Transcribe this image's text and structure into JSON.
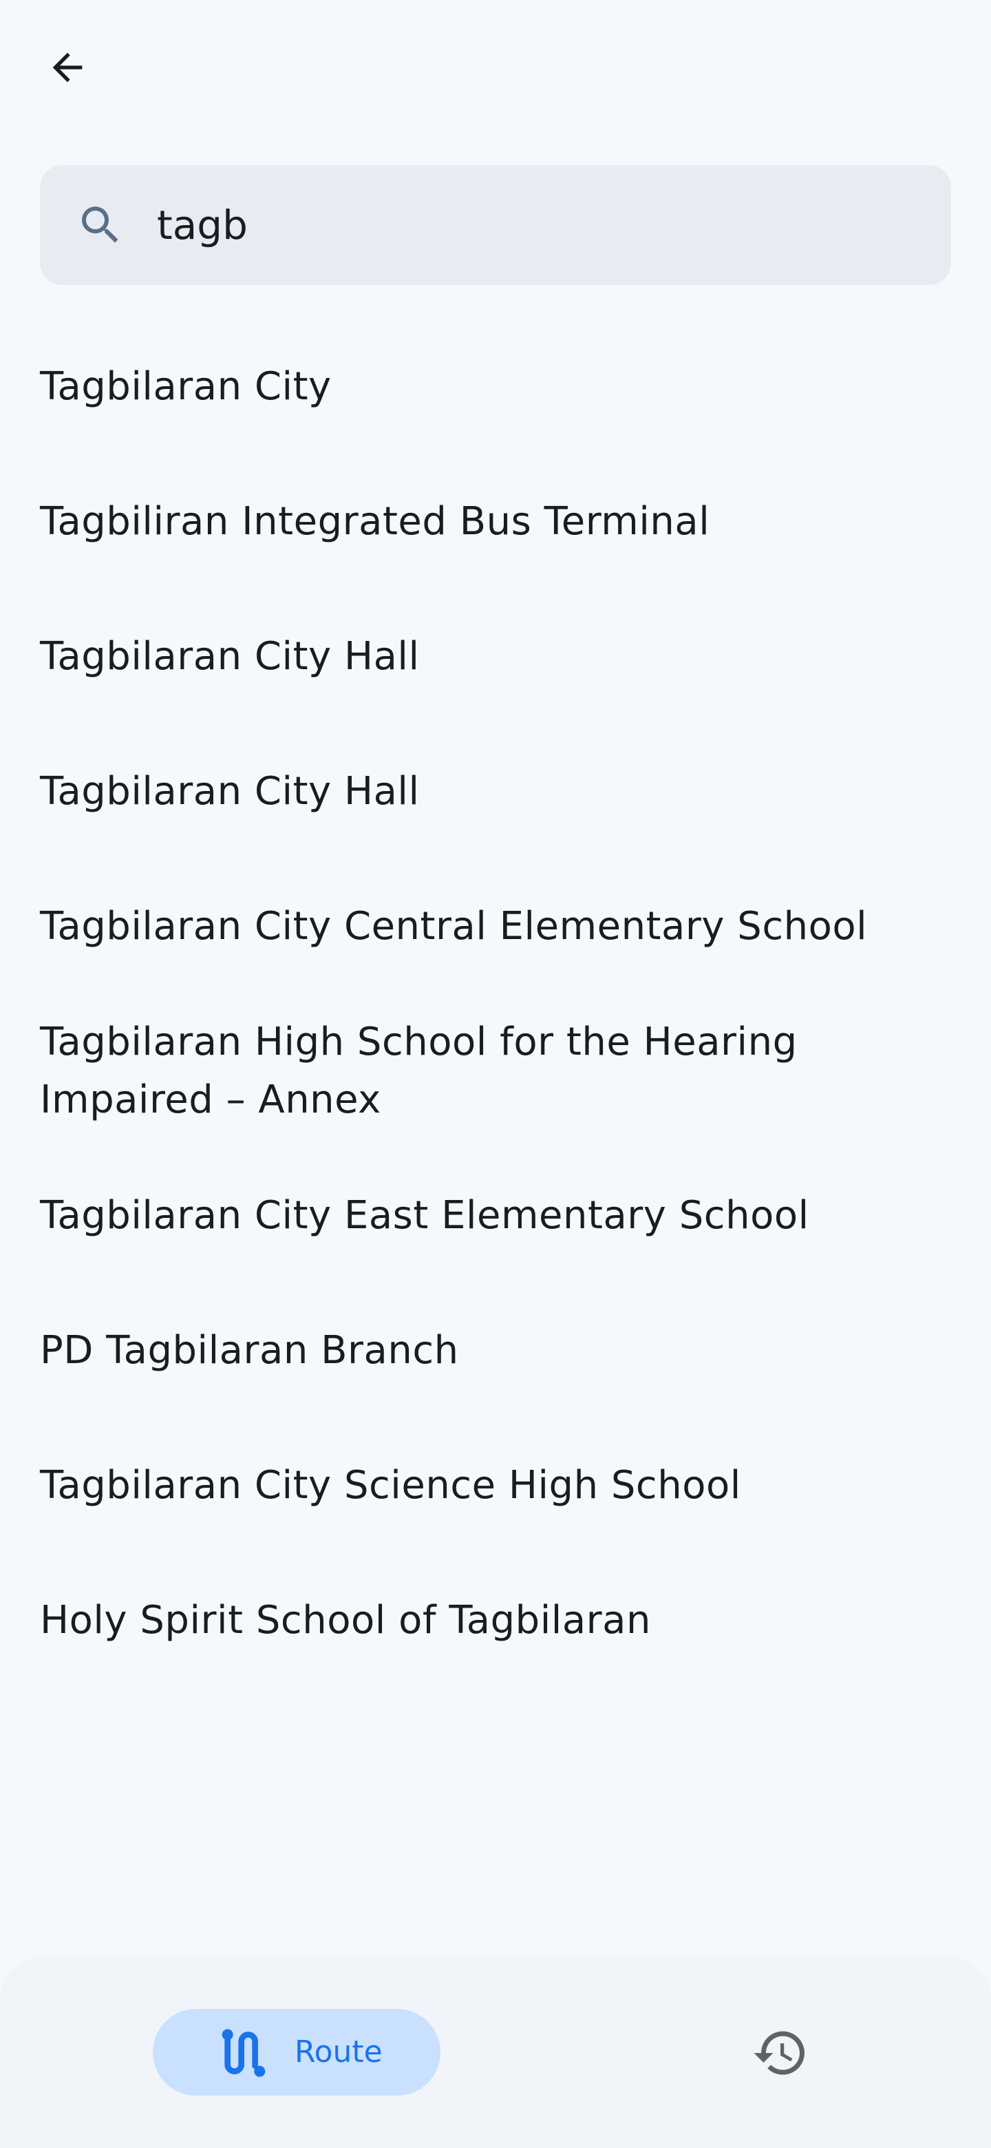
{
  "search": {
    "value": "tagb"
  },
  "results": [
    {
      "label": "Tagbilaran City"
    },
    {
      "label": "Tagbiliran Integrated Bus Terminal"
    },
    {
      "label": "Tagbilaran City Hall"
    },
    {
      "label": "Tagbilaran City Hall"
    },
    {
      "label": "Tagbilaran City Central Elementary School"
    },
    {
      "label": "Tagbilaran High School for the Hearing Impaired – Annex"
    },
    {
      "label": "Tagbilaran City East Elementary School"
    },
    {
      "label": "PD Tagbilaran Branch"
    },
    {
      "label": "Tagbilaran City Science High School"
    },
    {
      "label": "Holy Spirit School of Tagbilaran"
    }
  ],
  "bottom_nav": {
    "route_label": "Route",
    "route_icon": "route-icon",
    "history_icon": "history-icon"
  },
  "icons": {
    "back": "arrow-back-icon",
    "search": "search-icon"
  },
  "colors": {
    "accent": "#1a73e8",
    "route_pill": "#c9e0ff",
    "search_bg": "#e8ecf2",
    "background": "#f6f9fc"
  }
}
